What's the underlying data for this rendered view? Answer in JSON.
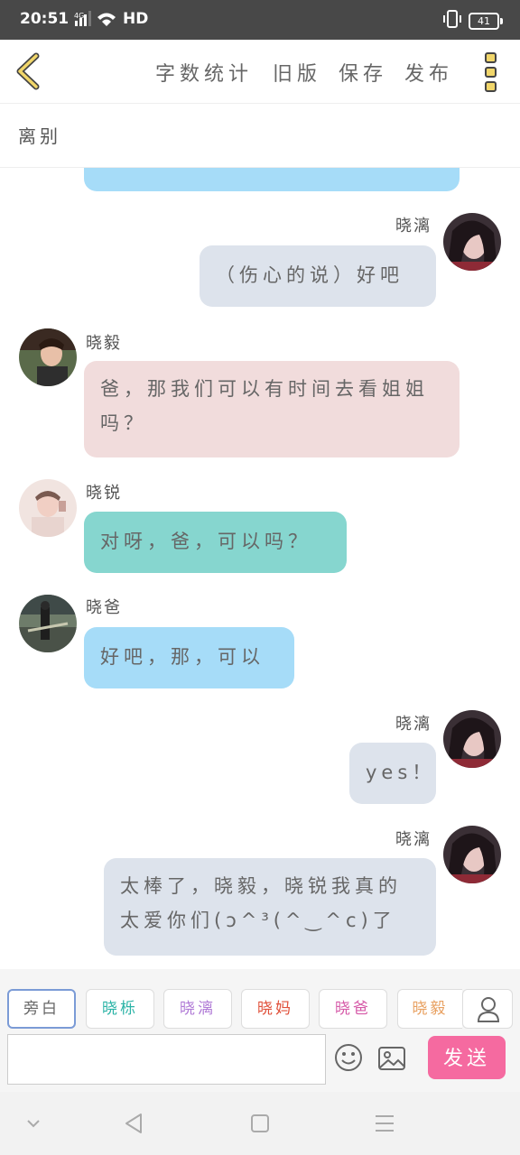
{
  "status": {
    "time": "20:51",
    "network": "4G",
    "hd": "HD",
    "battery": "41"
  },
  "toolbar": {
    "word_count": "字数统计",
    "old_version": "旧版",
    "save": "保存",
    "publish": "发布"
  },
  "chapter_title": "离别",
  "messages": [
    {
      "sender": "",
      "text": "",
      "side": "left",
      "color": "#a6dcf8"
    },
    {
      "sender": "晓漓",
      "text": "（伤心的说）好吧",
      "side": "right",
      "color": "#dde3ec"
    },
    {
      "sender": "晓毅",
      "text": "爸，那我们可以有时间去看姐姐吗？",
      "side": "left",
      "color": "#f1dcdc"
    },
    {
      "sender": "晓锐",
      "text": "对呀，爸，可以吗？",
      "side": "left",
      "color": "#86d6cf"
    },
    {
      "sender": "晓爸",
      "text": "好吧，那，可以",
      "side": "left",
      "color": "#a6dcf8"
    },
    {
      "sender": "晓漓",
      "text": "yes！",
      "side": "right",
      "color": "#dde3ec"
    },
    {
      "sender": "晓漓",
      "text": "太棒了，晓毅，晓锐我真的太爱你们(ɔ^³(^‿^c)了",
      "side": "right",
      "color": "#dde3ec"
    }
  ],
  "characters": [
    {
      "label": "旁白",
      "color": "#666666"
    },
    {
      "label": "晓栎",
      "color": "#2bb3a6"
    },
    {
      "label": "晓漓",
      "color": "#b07ad6"
    },
    {
      "label": "晓妈",
      "color": "#e0503a"
    },
    {
      "label": "晓爸",
      "color": "#d65aa8"
    },
    {
      "label": "晓毅",
      "color": "#e8a060"
    }
  ],
  "compose": {
    "placeholder": "",
    "send_label": "发送"
  }
}
